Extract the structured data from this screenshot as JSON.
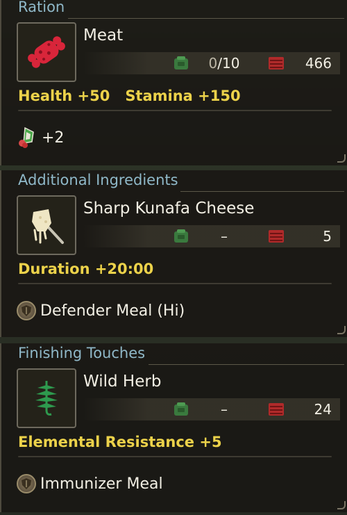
{
  "ration": {
    "title": "Ration",
    "item": {
      "name": "Meat",
      "icon": "meat-icon",
      "qty_current": "0",
      "qty_max": "10",
      "qty_sep": "/",
      "stock": "466"
    },
    "effects": [
      "Health +50",
      "Stamina +150"
    ],
    "bonus": {
      "icon": "bonus-fruit-icon",
      "text": "+2"
    }
  },
  "additional": {
    "title": "Additional Ingredients",
    "item": {
      "name": "Sharp Kunafa Cheese",
      "icon": "cheese-icon",
      "qty": "–",
      "stock": "5"
    },
    "effects": [
      "Duration +20:00"
    ],
    "skill": {
      "icon": "shield-icon",
      "text": "Defender Meal (Hi)"
    }
  },
  "finishing": {
    "title": "Finishing Touches",
    "item": {
      "name": "Wild Herb",
      "icon": "herb-icon",
      "qty": "–",
      "stock": "24"
    },
    "effects": [
      "Elemental Resistance +5"
    ],
    "skill": {
      "icon": "shield-icon",
      "text": "Immunizer Meal"
    }
  },
  "colors": {
    "effect": "#ecd24a",
    "section_title": "#8fb8c8",
    "pouch": "#3a7a3e",
    "box": "#b02a2a"
  }
}
